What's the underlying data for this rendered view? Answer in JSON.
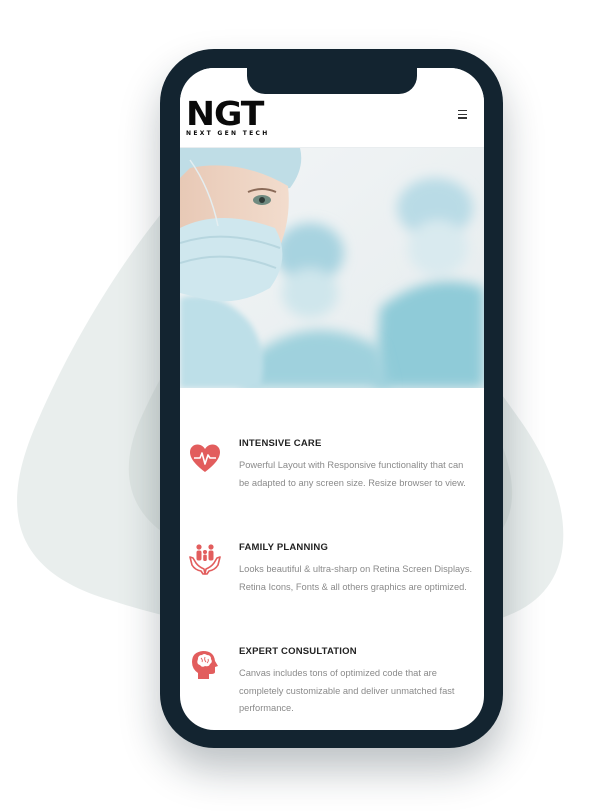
{
  "brand": {
    "logo_mark": "NGT",
    "logo_tagline": "NEXT GEN TECH"
  },
  "header": {
    "menu_icon": "hamburger-menu-icon"
  },
  "hero": {
    "image": "surgeons-in-masks-photo"
  },
  "colors": {
    "accent": "#e25d5d",
    "phone_frame": "#132430",
    "text_body": "#8a8a8a",
    "text_heading": "#222222"
  },
  "features": [
    {
      "icon": "heart-pulse-icon",
      "title": "INTENSIVE CARE",
      "text": "Powerful Layout with Responsive functionality that can be adapted to any screen size. Resize browser to view."
    },
    {
      "icon": "family-hands-icon",
      "title": "FAMILY PLANNING",
      "text": "Looks beautiful & ultra-sharp on Retina Screen Displays. Retina Icons, Fonts & all others graphics are optimized."
    },
    {
      "icon": "head-brain-icon",
      "title": "EXPERT CONSULTATION",
      "text": "Canvas includes tons of optimized code that are completely customizable and deliver unmatched fast performance."
    }
  ]
}
